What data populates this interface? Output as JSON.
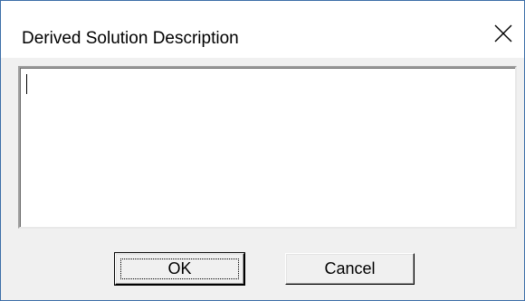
{
  "dialog": {
    "title": "Derived Solution Description",
    "close_icon": "close-icon"
  },
  "description": {
    "value": ""
  },
  "buttons": {
    "ok_label": "OK",
    "cancel_label": "Cancel"
  },
  "colors": {
    "window_border": "#3c6ea8",
    "dialog_background": "#f0f0f0",
    "titlebar_background": "#ffffff"
  }
}
